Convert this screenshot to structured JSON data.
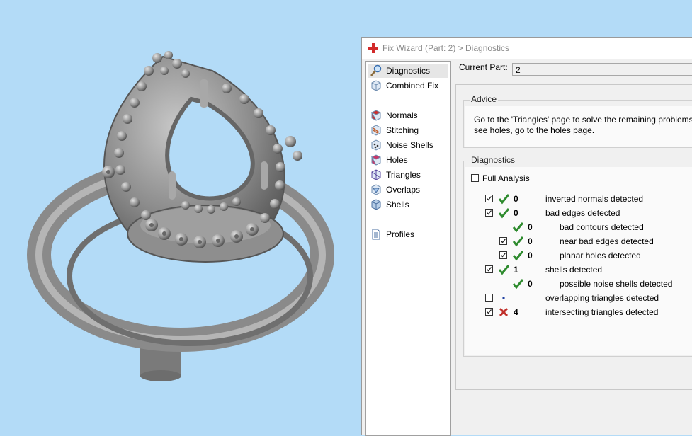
{
  "dialog": {
    "title": "Fix Wizard (Part: 2) > Diagnostics"
  },
  "nav": {
    "items": [
      {
        "label": "Diagnostics",
        "icon": "magnifier-icon"
      },
      {
        "label": "Combined Fix",
        "icon": "cube-icon"
      },
      {
        "label": "Normals",
        "icon": "red-cube-icon"
      },
      {
        "label": "Stitching",
        "icon": "stitch-cube-icon"
      },
      {
        "label": "Noise Shells",
        "icon": "noise-cube-icon"
      },
      {
        "label": "Holes",
        "icon": "holes-cube-icon"
      },
      {
        "label": "Triangles",
        "icon": "triangles-cube-icon"
      },
      {
        "label": "Overlaps",
        "icon": "overlaps-cube-icon"
      },
      {
        "label": "Shells",
        "icon": "shells-cube-icon"
      },
      {
        "label": "Profiles",
        "icon": "document-icon"
      }
    ]
  },
  "current_part": {
    "label": "Current Part:",
    "value": "2"
  },
  "advice": {
    "title": "Advice",
    "line1": "Go to the 'Triangles' page to solve the remaining problems. H",
    "line2": "see holes, go to the holes page."
  },
  "diagnostics": {
    "title": "Diagnostics",
    "full_analysis": {
      "label": "Full Analysis",
      "checked": false
    },
    "rows": [
      {
        "checkbox": true,
        "status": "ok",
        "count": "0",
        "label": "inverted normals detected"
      },
      {
        "checkbox": true,
        "status": "ok",
        "count": "0",
        "label": "bad edges detected"
      },
      {
        "checkbox": null,
        "status": "ok",
        "count": "0",
        "label": "bad contours detected"
      },
      {
        "checkbox": true,
        "status": "ok",
        "count": "0",
        "label": "near bad edges detected"
      },
      {
        "checkbox": true,
        "status": "ok",
        "count": "0",
        "label": "planar holes detected"
      },
      {
        "checkbox": true,
        "status": "ok",
        "count": "1",
        "label": "shells detected"
      },
      {
        "checkbox": null,
        "status": "ok",
        "count": "0",
        "label": "possible noise shells detected"
      },
      {
        "checkbox": false,
        "status": "none",
        "count": "",
        "label": "overlapping triangles detected"
      },
      {
        "checkbox": true,
        "status": "error",
        "count": "4",
        "label": "intersecting triangles detected"
      }
    ]
  },
  "colors": {
    "viewport_background": "#b3dbf7",
    "ok_check": "#2e8b2e",
    "error_cross": "#c0302a",
    "model_gray": "#8a8a8a"
  }
}
